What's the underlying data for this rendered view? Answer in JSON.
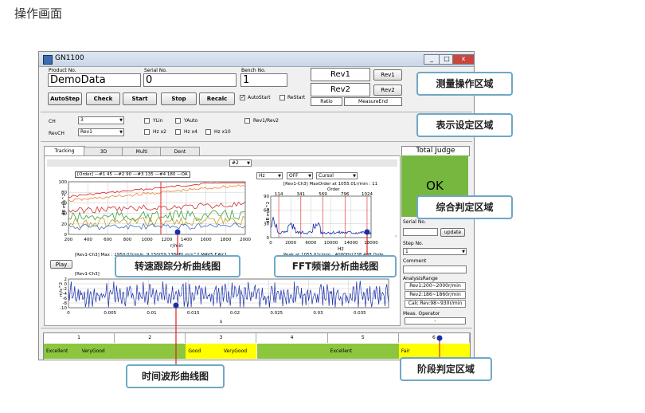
{
  "page_title": "操作画面",
  "window": {
    "title": "GN1100",
    "controls": [
      "_",
      "□",
      "x"
    ]
  },
  "measure": {
    "product_label": "Product No.",
    "product_value": "DemoData",
    "serial_label": "Serial No.",
    "serial_value": "0",
    "bench_label": "Bench No.",
    "bench_value": "1",
    "buttons": [
      "AutoStep",
      "Check",
      "Start",
      "Stop",
      "Recalc"
    ],
    "autostart_label": "AutoStart",
    "restart_label": "ReStart",
    "rev1_display": "Rev1",
    "rev2_display": "Rev2",
    "rev1_button": "Rev1",
    "rev2_button": "Rev2",
    "ratio_label": "Ratio",
    "measureend_label": "MeasureEnd"
  },
  "display": {
    "ch_label": "CH",
    "ch_value": "3",
    "revch_label": "RevCH",
    "revch_value": "Rev1",
    "ylin": "YLin",
    "yauto": "YAuto",
    "hzx2": "Hz x2",
    "hzx4": "Hz x4",
    "hzx10": "Hz x10",
    "rev1rev2": "Rev1/Rev2"
  },
  "tabs": [
    "Tracking",
    "3D",
    "Multi",
    "Dent"
  ],
  "graph": {
    "order_select": "#2",
    "legend": "[Order] —#1 45 —#2 90 —#3 135 —#4 180 —OA",
    "hz_select": "Hz",
    "off_select": "OFF",
    "cursor_select": "Cursol",
    "tracking_ylabel": "dB m/s^2",
    "tracking_xlabel": "r/min",
    "tracking_yticks": [
      "100",
      "80",
      "60",
      "40",
      "20",
      "0"
    ],
    "tracking_xticks": [
      "200",
      "400",
      "600",
      "800",
      "1000",
      "1200",
      "1400",
      "1600",
      "1800",
      "2000"
    ],
    "tracking_footer": "[Rev1-Ch3] Max : 1950.02r/min, 9.150(59.138dB) m/s^2  MAV5  F.AV.1",
    "fft_header": "[Rev1-Ch3] MaxOrder at 1055.01r/min : 11",
    "fft_order_label": "Order",
    "fft_order_ticks": [
      "114",
      "341",
      "569",
      "796",
      "1024"
    ],
    "fft_ylabel": "dB m/s^2",
    "fft_yticks": [
      "90",
      "60",
      "30",
      "0"
    ],
    "fft_xticks": [
      "0",
      "2000",
      "6000",
      "10000",
      "14000",
      "18000"
    ],
    "fft_xlabel": "Hz",
    "fft_footer": "Peak at 1055.01r/min : 4000Hz(238.488 Orde",
    "play_button": "Play",
    "time_header": "[Rev1-Ch3]",
    "time_ylabel": "m/s^2",
    "time_yticks": [
      "2",
      "0",
      "-2",
      "-4",
      "-6",
      "-8",
      "-10"
    ],
    "time_xticks": [
      "0",
      "0.005",
      "0.01",
      "0.015",
      "0.02",
      "0.025",
      "0.03",
      "0.035"
    ],
    "time_xlabel": "s"
  },
  "judge": {
    "title": "Total Judge",
    "result": "OK",
    "serial_label": "Serial No.",
    "update_button": "update",
    "step_label": "Step No.",
    "step_value": "1",
    "comment_label": "Comment",
    "analysis_label": "AnalysisRange",
    "ranges": [
      "Rev1:200~2000r/min",
      "Rev2:186~1860r/min",
      "Calc Rev:98~930r/min"
    ],
    "operator_label": "Meas. Operator",
    "operator_value": "-"
  },
  "stages": [
    {
      "num": "1",
      "left": "Excellent",
      "right": "VeryGood"
    },
    {
      "num": "2",
      "left": "",
      "right": ""
    },
    {
      "num": "3",
      "left": "Good",
      "right": "VeryGood"
    },
    {
      "num": "4",
      "left": "",
      "right": ""
    },
    {
      "num": "5",
      "left": "Excellent",
      "right": ""
    },
    {
      "num": "6",
      "left": "Fair",
      "right": ""
    }
  ],
  "callouts": {
    "measure": "测量操作区域",
    "display": "表示设定区域",
    "judge": "综合判定区域",
    "tracking": "转速跟踪分析曲线图",
    "fft": "FFT频谱分析曲线图",
    "time": "时间波形曲线图",
    "stage": "阶段判定区域"
  },
  "colors": {
    "ok_green": "#76b83f",
    "stage_green": "#8cc63f",
    "stage_yellow": "#ffff00",
    "callout_border": "#6fa8c7",
    "red_line": "#e02020",
    "fft_blue": "#1a2fa8"
  }
}
